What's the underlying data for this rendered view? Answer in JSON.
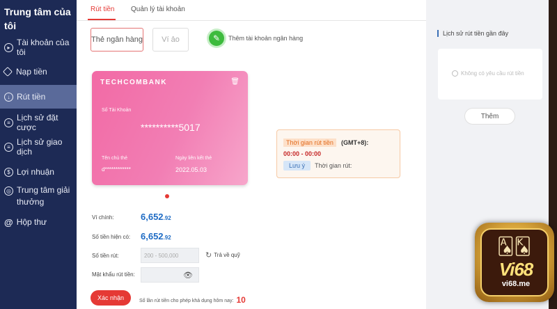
{
  "sidebar": {
    "title_line1": "Trung tâm của",
    "title_line2": "tôi",
    "items": [
      {
        "label": "Tài khoản của tôi"
      },
      {
        "label": "Nạp tiền"
      },
      {
        "label": "Rút tiền"
      },
      {
        "label": "Lịch sử đặt cược"
      },
      {
        "label": "Lịch sử giao dịch"
      },
      {
        "label": "Lợi nhuận"
      },
      {
        "label_line1": "Trung tâm giải",
        "label_line2": "thưởng"
      },
      {
        "label": "Hộp thư"
      }
    ]
  },
  "tabs": [
    {
      "label": "Rút tiền"
    },
    {
      "label": "Quản lý tài khoản"
    }
  ],
  "method": {
    "bank_card": "Thẻ ngân hàng",
    "virtual_wallet": "Ví ảo",
    "add_bank": "Thêm tài khoản ngân hàng"
  },
  "card": {
    "bank": "TECHCOMBANK",
    "account_label": "Số Tài Khoản",
    "account_number": "**********5017",
    "owner_label": "Tên chủ thẻ",
    "owner_value": "d************",
    "expiry_label": "Ngày liên kết thẻ",
    "expiry_value": "2022.05.03"
  },
  "withdraw_time": {
    "label": "Thời gian rút tiền",
    "timezone": "(GMT+8):",
    "range": "00:00 - 00:00",
    "note_tag": "Lưu ý",
    "note_text": "Thời gian rút:"
  },
  "form": {
    "wallet_label": "Ví chính:",
    "wallet_value": "6,652",
    "wallet_decimal": ".92",
    "available_label": "Số tiền hiện có:",
    "available_value": "6,652",
    "available_decimal": ".92",
    "amount_label": "Số tiền rút:",
    "amount_placeholder": "200 - 500,000",
    "reset_label": "Trả về quỹ",
    "password_label": "Mật khẩu rút tiền:",
    "confirm_label": "Xác nhận",
    "quota_label": "Số lần rút tiền cho phép khả dụng hôm nay:",
    "quota_value": "10"
  },
  "history": {
    "title": "Lịch sử rút tiền gần đây",
    "empty": "Không có yêu cầu rút tiền",
    "more_label": "Thêm"
  },
  "logo": {
    "brand": "Vi68",
    "domain": "vi68.me"
  },
  "colors": {
    "sidebar_bg": "#1d2a55",
    "accent_red": "#e53935",
    "amount_blue": "#1e6bc4",
    "card_pink": "#f26aa5"
  }
}
